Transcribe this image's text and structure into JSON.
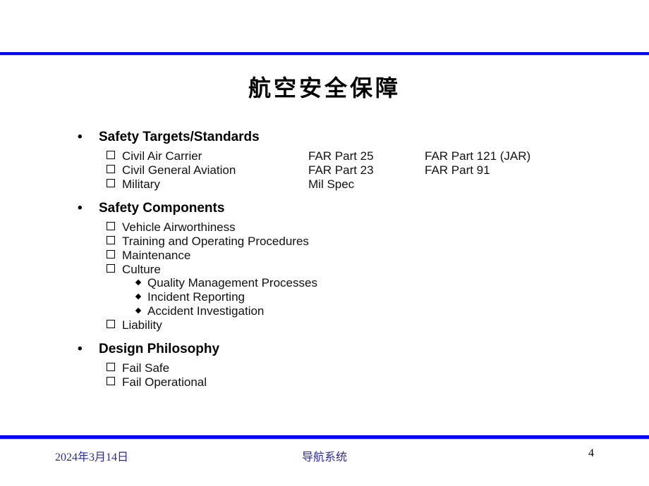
{
  "slide": {
    "title": "航空安全保障",
    "accent_color": "#0000ff",
    "sections": [
      {
        "heading": "Safety Targets/Standards",
        "items": [
          {
            "label": "Civil Air Carrier",
            "col2": "FAR Part 25",
            "col3": "FAR Part 121 (JAR)"
          },
          {
            "label": "Civil General Aviation",
            "col2": "FAR Part 23",
            "col3": "FAR Part 91"
          },
          {
            "label": "Military",
            "col2": "Mil Spec",
            "col3": ""
          }
        ]
      },
      {
        "heading": "Safety Components",
        "items": [
          {
            "label": "Vehicle Airworthiness"
          },
          {
            "label": "Training and Operating Procedures"
          },
          {
            "label": "Maintenance"
          },
          {
            "label": "Culture",
            "subitems": [
              "Quality Management Processes",
              "Incident Reporting",
              "Accident Investigation"
            ]
          },
          {
            "label": "Liability"
          }
        ]
      },
      {
        "heading": "Design Philosophy",
        "items": [
          {
            "label": "Fail Safe"
          },
          {
            "label": "Fail Operational"
          }
        ]
      }
    ],
    "bullet_l1": "•"
  },
  "footer": {
    "date": "2024年3月14日",
    "center": "导航系统",
    "page_number": "4"
  }
}
